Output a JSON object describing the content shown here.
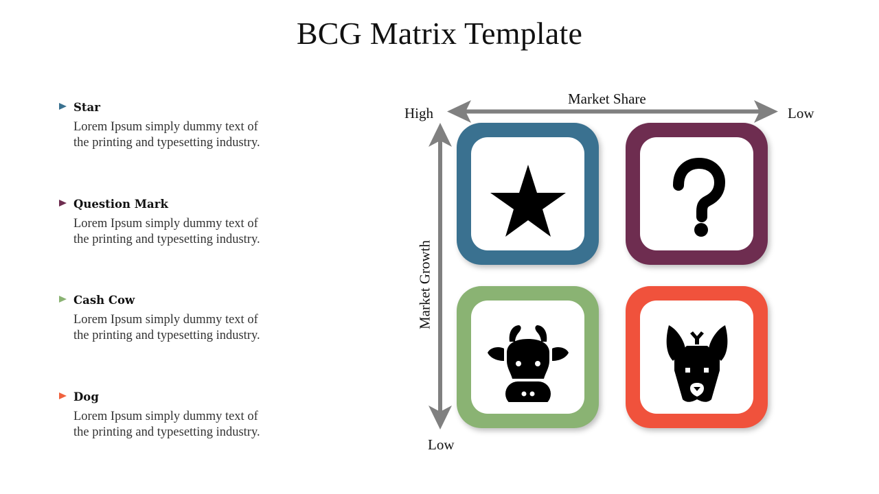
{
  "title": "BCG Matrix Template",
  "legend": [
    {
      "title": "Star",
      "desc_line1": "Lorem Ipsum simply dummy text of",
      "desc_line2": "the printing and typesetting industry.",
      "color": "#3a7190"
    },
    {
      "title": "Question Mark",
      "desc_line1": "Lorem Ipsum simply dummy text of",
      "desc_line2": "the printing and typesetting industry.",
      "color": "#6e2d50"
    },
    {
      "title": "Cash Cow",
      "desc_line1": "Lorem Ipsum simply dummy text of",
      "desc_line2": "the printing and typesetting industry.",
      "color": "#8ab373"
    },
    {
      "title": "Dog",
      "desc_line1": "Lorem Ipsum simply dummy text of",
      "desc_line2": "the printing and typesetting industry.",
      "color": "#f0623e"
    }
  ],
  "axes": {
    "horizontal": {
      "title": "Market Share",
      "start_label": "High",
      "end_label": "Low"
    },
    "vertical": {
      "title": "Market Growth",
      "end_label": "Low"
    },
    "arrow_color": "#808080"
  },
  "quadrants": [
    {
      "name": "Star",
      "icon": "star-icon",
      "color": "#3a7190"
    },
    {
      "name": "Question Mark",
      "icon": "question-mark-icon",
      "color": "#6e2d50"
    },
    {
      "name": "Cash Cow",
      "icon": "cow-icon",
      "color": "#8ab373"
    },
    {
      "name": "Dog",
      "icon": "dog-icon",
      "color": "#f0523c"
    }
  ]
}
